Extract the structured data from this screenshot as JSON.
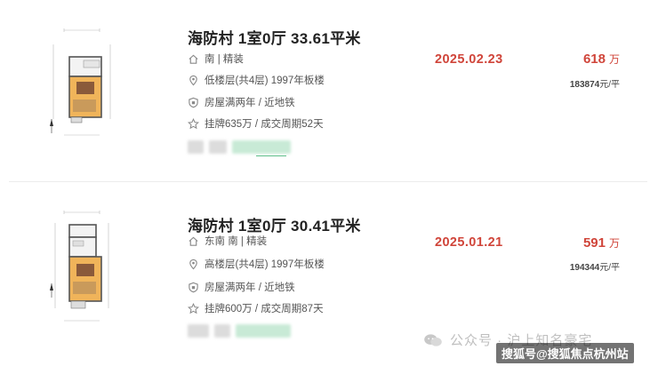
{
  "listings": [
    {
      "title": "海防村 1室0厅 33.61平米",
      "orientation": "南 | 精装",
      "floor": "低楼层(共4层) 1997年板楼",
      "features": "房屋满两年 / 近地铁",
      "listing_info": "挂牌635万 / 成交周期52天",
      "deal_date": "2025.02.23",
      "total_price": "618",
      "total_unit": "万",
      "unit_price": "183874",
      "unit_price_suffix": "元/平"
    },
    {
      "title": "海防村 1室0厅 30.41平米",
      "orientation": "东南 南 | 精装",
      "floor": "高楼层(共4层) 1997年板楼",
      "features": "房屋满两年 / 近地铁",
      "listing_info": "挂牌600万 / 成交周期87天",
      "deal_date": "2025.01.21",
      "total_price": "591",
      "total_unit": "万",
      "unit_price": "194344",
      "unit_price_suffix": "元/平"
    }
  ],
  "icons": {
    "orientation": "house-icon",
    "floor": "location-pin-icon",
    "features": "shield-icon",
    "listing": "star-icon"
  },
  "colors": {
    "price_red": "#d0453a",
    "title": "#222222",
    "text": "#555555"
  },
  "watermark": {
    "text": "公众号 · 沪上知名豪宅"
  },
  "source_badge": "搜狐号@搜狐焦点杭州站"
}
